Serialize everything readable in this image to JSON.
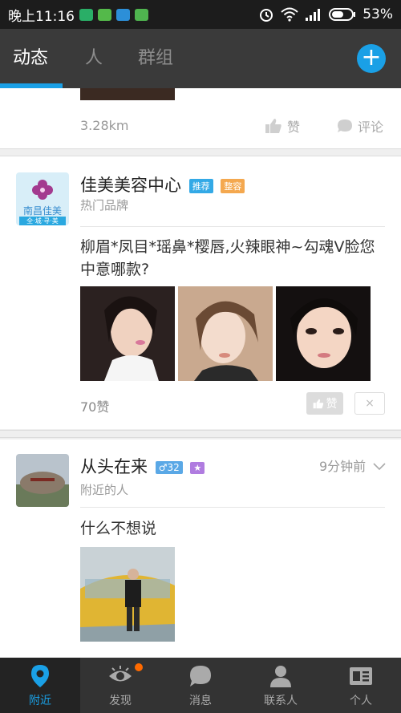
{
  "status_bar": {
    "time": "晚上11:16",
    "battery": "53%",
    "icons": [
      "wechat-icon",
      "tips-icon",
      "signal-app-icon",
      "app-icon",
      "alarm-icon",
      "wifi-icon",
      "cell-signal-icon",
      "battery-icon"
    ]
  },
  "tabs": [
    {
      "label": "动态",
      "active": true
    },
    {
      "label": "人",
      "active": false
    },
    {
      "label": "群组",
      "active": false
    }
  ],
  "add_button": "+",
  "posts": [
    {
      "distance": "3.28km",
      "like_label": "赞",
      "comment_label": "评论"
    },
    {
      "name": "佳美美容中心",
      "badges": [
        {
          "text": "推荐",
          "color": "#33a9e6"
        },
        {
          "text": "整容",
          "color": "#f4a84f"
        }
      ],
      "subtitle": "热门品牌",
      "avatar_text": "南昌佳美",
      "avatar_subtext": "全·城·寻·美",
      "text": "柳眉*凤目*瑶鼻*樱唇,火辣眼神~勾魂V脸您中意哪款?",
      "likes": "70赞",
      "like_button": "赞",
      "close": "×"
    },
    {
      "name": "从头在来",
      "gender_age": "♂32",
      "subtitle": "附近的人",
      "time": "9分钟前",
      "text": "什么不想说"
    }
  ],
  "bottom_nav": [
    {
      "label": "附近",
      "icon": "location-pin-icon",
      "active": true
    },
    {
      "label": "发现",
      "icon": "eye-icon",
      "active": false,
      "has_dot": true
    },
    {
      "label": "消息",
      "icon": "chat-bubble-icon",
      "active": false
    },
    {
      "label": "联系人",
      "icon": "person-icon",
      "active": false
    },
    {
      "label": "个人",
      "icon": "profile-card-icon",
      "active": false
    }
  ],
  "colors": {
    "accent": "#1aa0e6",
    "topbar": "#3a3a3a",
    "bottombar": "#333333",
    "dot": "#ff6a00"
  }
}
